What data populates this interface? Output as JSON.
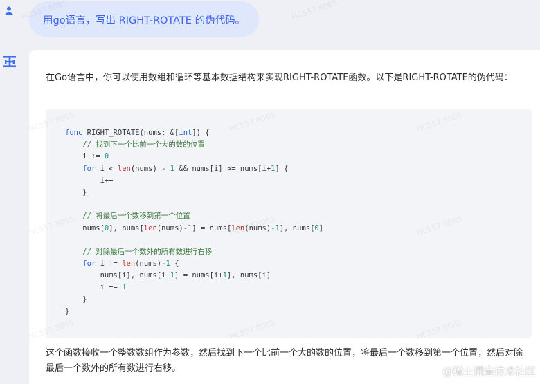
{
  "user_message": {
    "avatar_icon": "user-icon",
    "text": "用go语言，写出 RIGHT-ROTATE 的伪代码。"
  },
  "answer": {
    "avatar_icon": "logo-icon",
    "intro": "在Go语言中，你可以使用数组和循环等基本数据结构来实现RIGHT-ROTATE函数。以下是RIGHT-ROTATE的伪代码：",
    "code_lines": [
      [
        {
          "t": "func",
          "c": "kw"
        },
        {
          "t": " RIGHT_ROTATE(nums: &["
        },
        {
          "t": "int",
          "c": "kw"
        },
        {
          "t": "]) {"
        }
      ],
      [
        {
          "t": "    "
        },
        {
          "t": "// 找到下一个比前一个大的数的位置",
          "c": "cm"
        }
      ],
      [
        {
          "t": "    i := "
        },
        {
          "t": "0",
          "c": "num"
        }
      ],
      [
        {
          "t": "    "
        },
        {
          "t": "for",
          "c": "kw"
        },
        {
          "t": " i < "
        },
        {
          "t": "len",
          "c": "fn"
        },
        {
          "t": "(nums) - "
        },
        {
          "t": "1",
          "c": "num"
        },
        {
          "t": " && nums[i] >= nums[i+"
        },
        {
          "t": "1",
          "c": "num"
        },
        {
          "t": "] {"
        }
      ],
      [
        {
          "t": "        i++"
        }
      ],
      [
        {
          "t": "    }"
        }
      ],
      [
        {
          "t": ""
        }
      ],
      [
        {
          "t": "    "
        },
        {
          "t": "// 将最后一个数移到第一个位置",
          "c": "cm"
        }
      ],
      [
        {
          "t": "    nums["
        },
        {
          "t": "0",
          "c": "num"
        },
        {
          "t": "], nums["
        },
        {
          "t": "len",
          "c": "fn"
        },
        {
          "t": "(nums)-"
        },
        {
          "t": "1",
          "c": "num"
        },
        {
          "t": "] = nums["
        },
        {
          "t": "len",
          "c": "fn"
        },
        {
          "t": "(nums)-"
        },
        {
          "t": "1",
          "c": "num"
        },
        {
          "t": "], nums["
        },
        {
          "t": "0",
          "c": "num"
        },
        {
          "t": "]"
        }
      ],
      [
        {
          "t": ""
        }
      ],
      [
        {
          "t": "    "
        },
        {
          "t": "// 对除最后一个数外的所有数进行右移",
          "c": "cm"
        }
      ],
      [
        {
          "t": "    "
        },
        {
          "t": "for",
          "c": "kw"
        },
        {
          "t": " i != "
        },
        {
          "t": "len",
          "c": "fn"
        },
        {
          "t": "(nums)-"
        },
        {
          "t": "1",
          "c": "num"
        },
        {
          "t": " {"
        }
      ],
      [
        {
          "t": "        nums[i], nums[i+"
        },
        {
          "t": "1",
          "c": "num"
        },
        {
          "t": "] = nums[i+"
        },
        {
          "t": "1",
          "c": "num"
        },
        {
          "t": "], nums[i]"
        }
      ],
      [
        {
          "t": "        i += "
        },
        {
          "t": "1",
          "c": "num"
        }
      ],
      [
        {
          "t": "    }"
        }
      ],
      [
        {
          "t": "}"
        }
      ]
    ],
    "summary": "这个函数接收一个整数数组作为参数，然后找到下一个比前一个大的数的位置，将最后一个数移到第一个位置，然后对除最后一个数外的所有数进行右移。"
  },
  "watermark_text": "HC557 8065",
  "site_mark": "@稀土掘金技术社区",
  "colors": {
    "page_bg": "#eef0f5",
    "user_bubble_bg": "#dfe7fd",
    "user_text": "#3a62ea",
    "avatar_blue": "#3f6ef0",
    "code_bg": "#f3f4f7",
    "keyword": "#1f5fd1",
    "comment": "#3d7a3d",
    "number": "#1a8a8a",
    "builtin": "#b93a3a"
  }
}
